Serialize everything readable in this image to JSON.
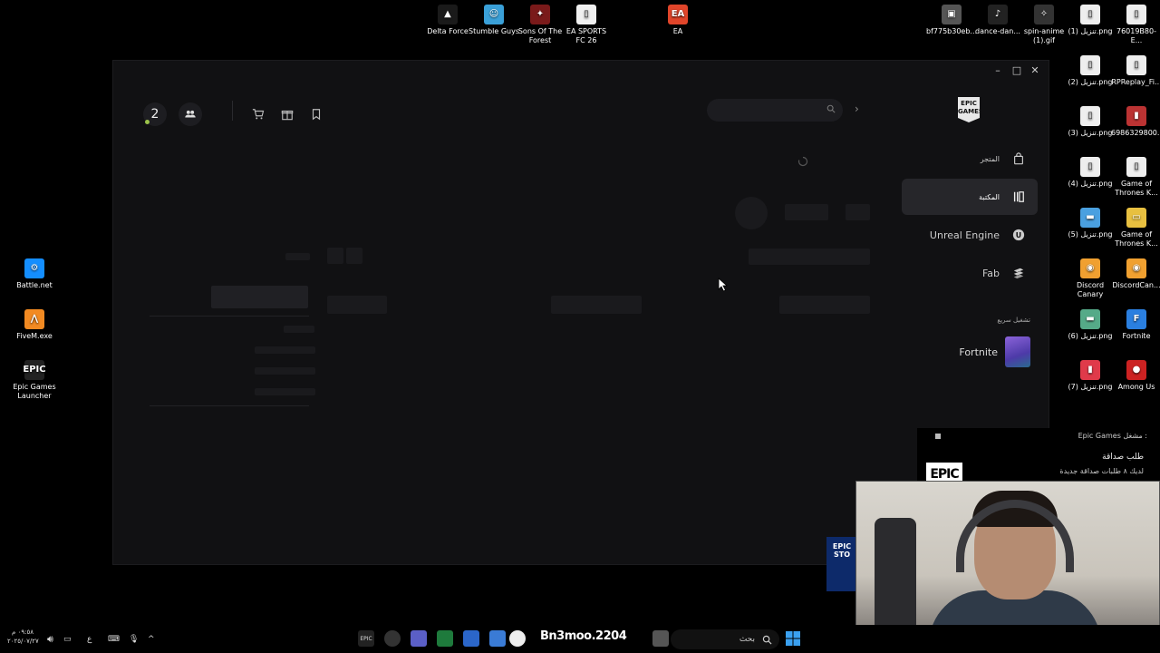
{
  "desktop_icons_top": [
    {
      "label": "Delta Force",
      "color": "#1a1a1a",
      "glyph": "▲"
    },
    {
      "label": "Stumble Guys",
      "color": "#3aa0d8",
      "glyph": "☺"
    },
    {
      "label": "Sons Of The Forest",
      "color": "#7a1a1a",
      "glyph": "✦"
    },
    {
      "label": "EA SPORTS FC 26",
      "color": "#f0f0f0",
      "glyph": "▯"
    },
    {
      "label": "EA",
      "color": "#e0452a",
      "glyph": "EA"
    },
    {
      "label": "bf775b30eb...",
      "color": "#555",
      "glyph": "▣"
    },
    {
      "label": "dance-dan...",
      "color": "#222",
      "glyph": "♪"
    },
    {
      "label": "spin-anime (1).gif",
      "color": "#333",
      "glyph": "✧"
    },
    {
      "label": "تنزيل (1).png",
      "color": "#eee",
      "glyph": "▯"
    },
    {
      "label": "76019B80-E...",
      "color": "#eee",
      "glyph": "▯"
    }
  ],
  "desktop_icons_left": [
    {
      "label": "Battle.net",
      "color": "#148eff",
      "glyph": "⚙"
    },
    {
      "label": "FiveM.exe",
      "color": "#f28a22",
      "glyph": "⋀"
    },
    {
      "label": "Epic Games Launcher",
      "color": "#222",
      "glyph": "EPIC"
    }
  ],
  "desktop_icons_right": [
    {
      "label": "تنزيل (2).png",
      "color": "#eee",
      "glyph": "▯"
    },
    {
      "label": "RPReplay_Fi...",
      "color": "#eee",
      "glyph": "▯"
    },
    {
      "label": "تنزيل (3).png",
      "color": "#eee",
      "glyph": "▯"
    },
    {
      "label": "6986329800...",
      "color": "#b33",
      "glyph": "▮"
    },
    {
      "label": "تنزيل (4).png",
      "color": "#eee",
      "glyph": "▯"
    },
    {
      "label": "Game of Thrones K...",
      "color": "#eee",
      "glyph": "▯"
    },
    {
      "label": "تنزيل (5).png",
      "color": "#4aa0e0",
      "glyph": "▬"
    },
    {
      "label": "Game of Thrones K...",
      "color": "#e8c040",
      "glyph": "▭"
    },
    {
      "label": "Discord Canary",
      "color": "#f0a030",
      "glyph": "◉"
    },
    {
      "label": "DiscordCan...",
      "color": "#f0a030",
      "glyph": "◉"
    },
    {
      "label": "تنزيل (6).png",
      "color": "#5a8",
      "glyph": "▬"
    },
    {
      "label": "Fortnite",
      "color": "#2a7fe0",
      "glyph": "F"
    },
    {
      "label": "تنزيل (7).png",
      "color": "#e03a4a",
      "glyph": "▮"
    },
    {
      "label": "Among Us",
      "color": "#c22",
      "glyph": "●"
    }
  ],
  "window": {
    "controls": {
      "minimize": "–",
      "maximize": "□",
      "close": "✕"
    },
    "friends_count": "2",
    "logo_text": "EPIC GAMES",
    "sidebar": {
      "items": [
        {
          "label": "المتجر",
          "icon": "bag-icon"
        },
        {
          "label": "المكتبة",
          "icon": "library-icon",
          "active": true
        },
        {
          "label": "Unreal Engine",
          "icon": "unreal-icon"
        },
        {
          "label": "Fab",
          "icon": "fab-icon"
        }
      ],
      "quick_launch_title": "تشغيل سريع",
      "quick_launch": [
        {
          "label": "Fortnite"
        }
      ]
    }
  },
  "notification": {
    "app": "Epic Games مشغل :",
    "title": "طلب صداقة",
    "body": "لديك ٨ طلبات صداقة جديدة",
    "logo": "EPIC"
  },
  "store_badge": "EPIC STO",
  "taskbar": {
    "clock_time": "٠٩:٥٨ م",
    "clock_date": "٢٠٢٥/٠٧/٢٧",
    "lang": "ع",
    "search_placeholder": "بحث",
    "overlay_text": "Bn3moo.2204"
  },
  "colors": {
    "window_bg": "#111113",
    "accent_online": "#9bc24a",
    "active_nav": "#26262a"
  }
}
